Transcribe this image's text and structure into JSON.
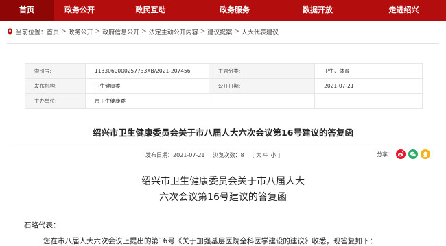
{
  "nav": [
    {
      "label": "首页",
      "active": true
    },
    {
      "label": "政务公开",
      "active": false
    },
    {
      "label": "政民互动",
      "active": false
    },
    {
      "label": "政务服务",
      "active": false
    },
    {
      "label": "数据开放",
      "active": false
    },
    {
      "label": "走进绍兴",
      "active": false
    }
  ],
  "breadcrumb": {
    "prefix": "当前位置：",
    "items": [
      "首页",
      "政务公开",
      "政府信息公开",
      "法定主动公开内容",
      "建议提案",
      "人大代表建议"
    ],
    "separator": ">"
  },
  "info": {
    "index_label": "索引号:",
    "index_value": "113306000025773​3XB/2021-207456",
    "topic_label": "主题分类:",
    "topic_value": "卫生、体育",
    "issuer_label": "发布机构:",
    "issuer_value": "卫生健康委",
    "date_label": "公开日期:",
    "date_value": "2021-07-21",
    "host_label": "主办单位:",
    "host_value": "市卫生健康委"
  },
  "doc": {
    "title": "绍兴市卫生健康委员会关于市八届人大六次会议第16号建议的答复函",
    "publish_label": "发布日期：",
    "publish_date": "2021-07-21",
    "views_label": "浏览次数：",
    "views": "8",
    "font_sizes": "[ 大 中 小 ]",
    "share_label": "分享：",
    "subtitle_line1": "绍兴市卫生健康委员会关于市八届人大",
    "subtitle_line2": "六次会议第16号建议的答复函",
    "salutation": "石略代表：",
    "body_line1": "您在市八届人大六次会议上提出的第16号《关于加强基层医院全科医学建设的建议》收悉，现答复如下："
  },
  "colors": {
    "nav_bg": "#b40d0d",
    "nav_active": "#8e0606",
    "weibo": "#e6162d",
    "wechat": "#2aae67",
    "qq": "#f5b21a"
  }
}
